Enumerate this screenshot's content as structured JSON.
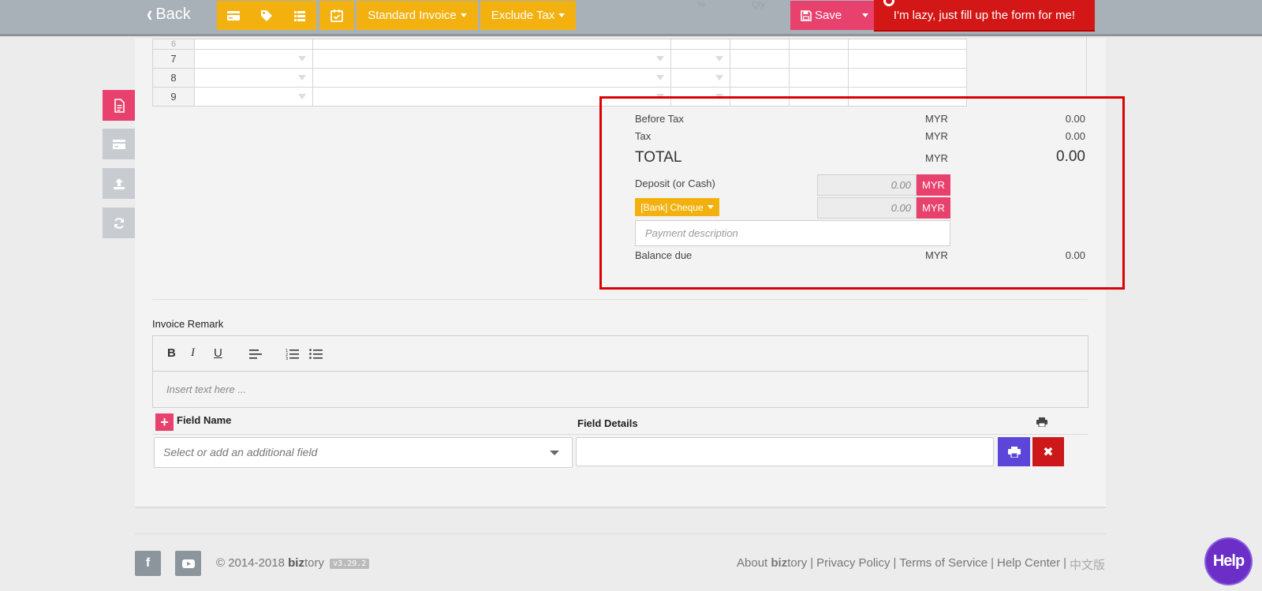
{
  "toolbar": {
    "back_label": "Back",
    "invoice_type": "Standard Invoice",
    "tax_mode": "Exclude Tax",
    "ghost_pct": "%",
    "ghost_qty": "Qty",
    "save_label": "Save",
    "lazy_label": "I'm lazy, just fill up the form for me!",
    "accent_yellow": "#f2b10f",
    "accent_pink": "#e8416d",
    "accent_red": "#d31616"
  },
  "side_tabs": [
    {
      "icon": "document-icon",
      "active": true
    },
    {
      "icon": "credit-card-icon",
      "active": false
    },
    {
      "icon": "upload-icon",
      "active": false
    },
    {
      "icon": "refresh-icon",
      "active": false
    }
  ],
  "rows": [
    {
      "num": "6"
    },
    {
      "num": "7"
    },
    {
      "num": "8"
    },
    {
      "num": "9"
    }
  ],
  "summary": {
    "before_tax_label": "Before Tax",
    "before_tax_cur": "MYR",
    "before_tax_val": "0.00",
    "tax_label": "Tax",
    "tax_cur": "MYR",
    "tax_val": "0.00",
    "total_label": "TOTAL",
    "total_cur": "MYR",
    "total_val": "0.00",
    "deposit_label": "Deposit (or Cash)",
    "deposit_placeholder": "0.00",
    "deposit_cur": "MYR",
    "bank_label": "[Bank] Cheque",
    "bank_placeholder": "0.00",
    "bank_cur": "MYR",
    "pay_desc_placeholder": "Payment description",
    "balance_label": "Balance due",
    "balance_cur": "MYR",
    "balance_val": "0.00"
  },
  "remark": {
    "title": "Invoice Remark",
    "placeholder": "Insert text here ..."
  },
  "fields": {
    "name_header": "Field Name",
    "details_header": "Field Details",
    "select_placeholder": "Select or add an additional field"
  },
  "footer": {
    "copyright": "© 2014-2018",
    "brand_bold": "biz",
    "brand_rest": "tory",
    "version": "v3.29.2",
    "about_prefix": "About",
    "about_bold": "biz",
    "about_rest": "tory",
    "privacy": "Privacy Policy",
    "terms": "Terms of Service",
    "help_center": "Help Center",
    "chinese": "中文版",
    "sep": "|",
    "help_bubble": "Help"
  }
}
